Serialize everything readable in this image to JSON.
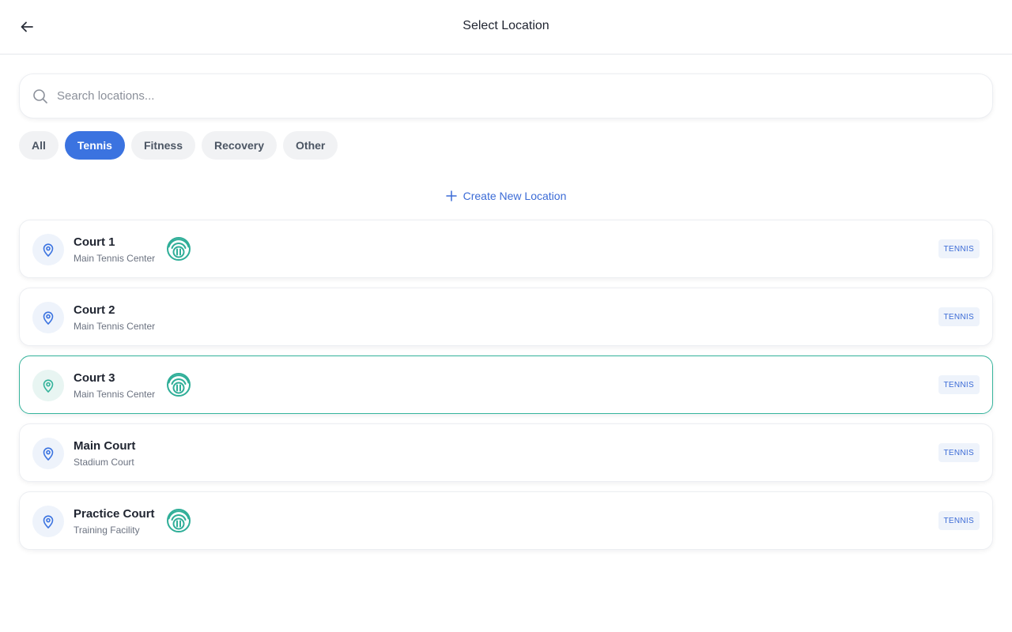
{
  "header": {
    "title": "Select Location"
  },
  "search": {
    "placeholder": "Search locations..."
  },
  "filters": [
    "All",
    "Tennis",
    "Fitness",
    "Recovery",
    "Other"
  ],
  "active_filter": "Tennis",
  "create_label": "Create New Location",
  "colors": {
    "accent": "#3b73e0",
    "selected_border": "#34b39b",
    "sensor": "#2fae98"
  },
  "locations": [
    {
      "title": "Court 1",
      "subtitle": "Main Tennis Center",
      "badge": "TENNIS",
      "has_sensor": true,
      "selected": false
    },
    {
      "title": "Court 2",
      "subtitle": "Main Tennis Center",
      "badge": "TENNIS",
      "has_sensor": false,
      "selected": false
    },
    {
      "title": "Court 3",
      "subtitle": "Main Tennis Center",
      "badge": "TENNIS",
      "has_sensor": true,
      "selected": true
    },
    {
      "title": "Main Court",
      "subtitle": "Stadium Court",
      "badge": "TENNIS",
      "has_sensor": false,
      "selected": false
    },
    {
      "title": "Practice Court",
      "subtitle": "Training Facility",
      "badge": "TENNIS",
      "has_sensor": true,
      "selected": false
    }
  ]
}
